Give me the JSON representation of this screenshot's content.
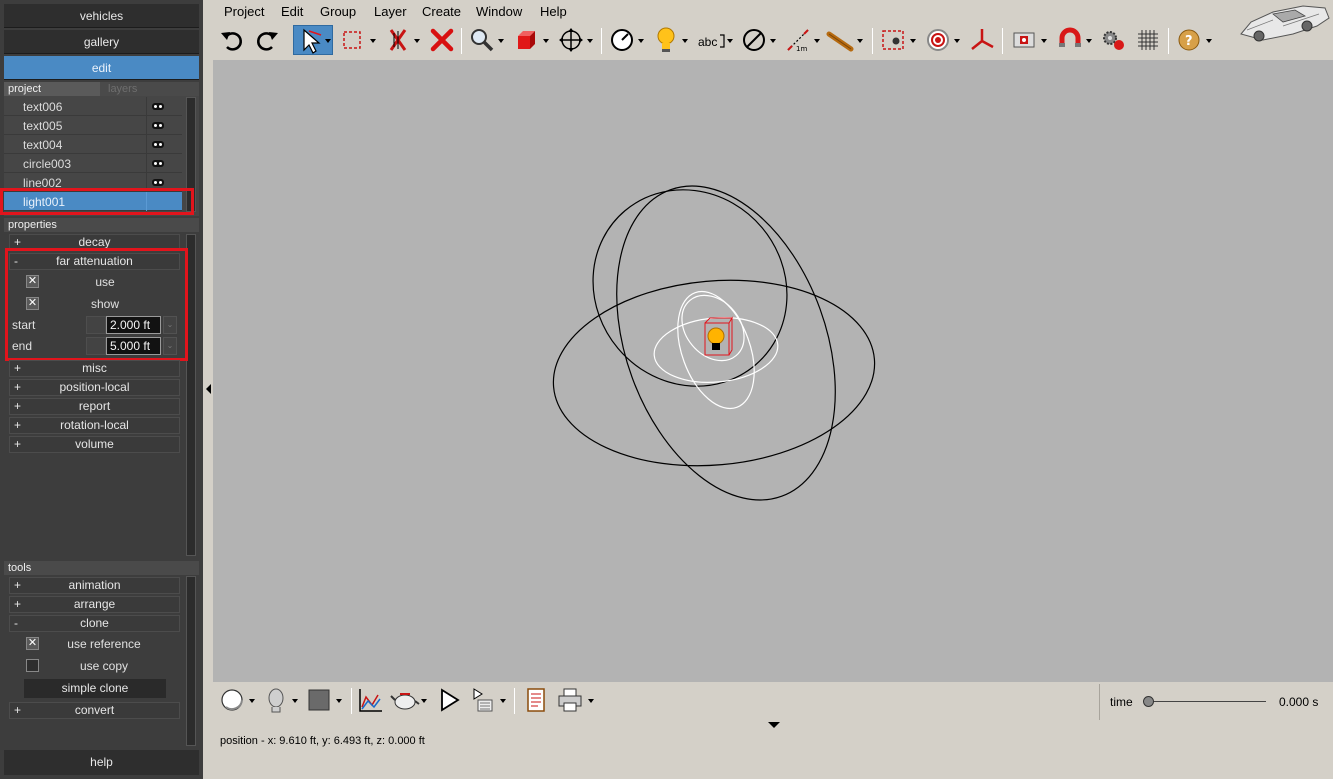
{
  "left_panel": {
    "buttons": {
      "vehicles": "vehicles",
      "gallery": "gallery",
      "edit": "edit",
      "help": "help"
    },
    "tabs": {
      "project": "project",
      "layers": "layers"
    },
    "objects": [
      "text006",
      "text005",
      "text004",
      "circle003",
      "line002",
      "light001"
    ],
    "selected_object": "light001",
    "properties": {
      "header": "properties",
      "groups": [
        "decay",
        "far attenuation",
        "misc",
        "position-local",
        "report",
        "rotation-local",
        "volume"
      ],
      "far_attenuation": {
        "use_label": "use",
        "show_label": "show",
        "start_label": "start",
        "start_value": "2.000 ft",
        "end_label": "end",
        "end_value": "5.000 ft"
      }
    },
    "tools": {
      "header": "tools",
      "groups": [
        "animation",
        "arrange",
        "clone",
        "convert"
      ],
      "clone": {
        "use_reference_label": "use reference",
        "use_copy_label": "use copy",
        "simple_clone_label": "simple clone"
      }
    },
    "plus": "+",
    "minus": "-",
    "check_mark": "✕"
  },
  "menubar": [
    "Project",
    "Edit",
    "Group",
    "Layer",
    "Create",
    "Window",
    "Help"
  ],
  "toolbar": {
    "text_tool_label": "abc",
    "icons": [
      "undo-icon",
      "redo-icon",
      "select-arrow-icon",
      "selection-rect-icon",
      "delete-selection-icon",
      "delete-icon",
      "zoom-icon",
      "box-icon",
      "move-icon",
      "clock-icon",
      "light-bulb-icon",
      "text-icon",
      "measure-angle-icon",
      "dimension-icon",
      "ruler-icon",
      "render-region-icon",
      "target-icon",
      "axis-icon",
      "camera-icon",
      "magnet-icon",
      "gears-icon",
      "grid-icon",
      "help-icon"
    ]
  },
  "bottom_toolbar": {
    "icons": [
      "sphere-shading-icon",
      "head-icon",
      "material-color-icon",
      "graph-icon",
      "teapot-icon",
      "play-icon",
      "render-sequence-icon",
      "report-icon",
      "print-icon"
    ]
  },
  "time": {
    "label": "time",
    "value": "0.000 s",
    "slider_position": 0
  },
  "status_text": "position - x: 9.610 ft, y: 6.493 ft, z: 0.000 ft",
  "colors": {
    "accent": "#4a8ac4",
    "highlight_red": "#e2141c",
    "viewport": "#b3b3b3",
    "panel": "#3d3d3d"
  }
}
